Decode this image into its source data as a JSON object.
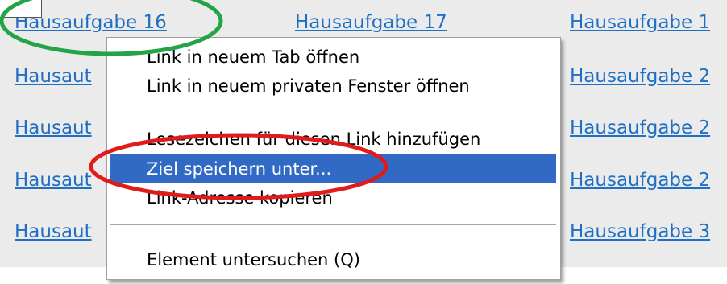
{
  "page": {
    "links": [
      {
        "label": "Hausaufgabe 16"
      },
      {
        "label": "Hausaufgabe 17"
      },
      {
        "label": "Hausaufgabe 1"
      },
      {
        "label": "Hausaut"
      },
      {
        "label": "Hausaufgabe 2"
      },
      {
        "label": "Hausaut"
      },
      {
        "label": "Hausaufgabe 2"
      },
      {
        "label": "Hausaut"
      },
      {
        "label": "Hausaufgabe 2"
      },
      {
        "label": "Hausaut"
      },
      {
        "label": "Hausaufgabe 3"
      }
    ]
  },
  "context_menu": {
    "items": [
      {
        "label": "Link in neuem Tab öffnen"
      },
      {
        "label": "Link in neuem privaten Fenster öffnen"
      },
      {
        "label": "Lesezeichen für diesen Link hinzufügen"
      },
      {
        "label": "Ziel speichern unter..."
      },
      {
        "label": "Link-Adresse kopieren"
      },
      {
        "label": "Element untersuchen (Q)"
      }
    ],
    "highlighted_index": 3
  },
  "annotations": {
    "green_color": "#22a447",
    "red_color": "#e01b1b"
  }
}
